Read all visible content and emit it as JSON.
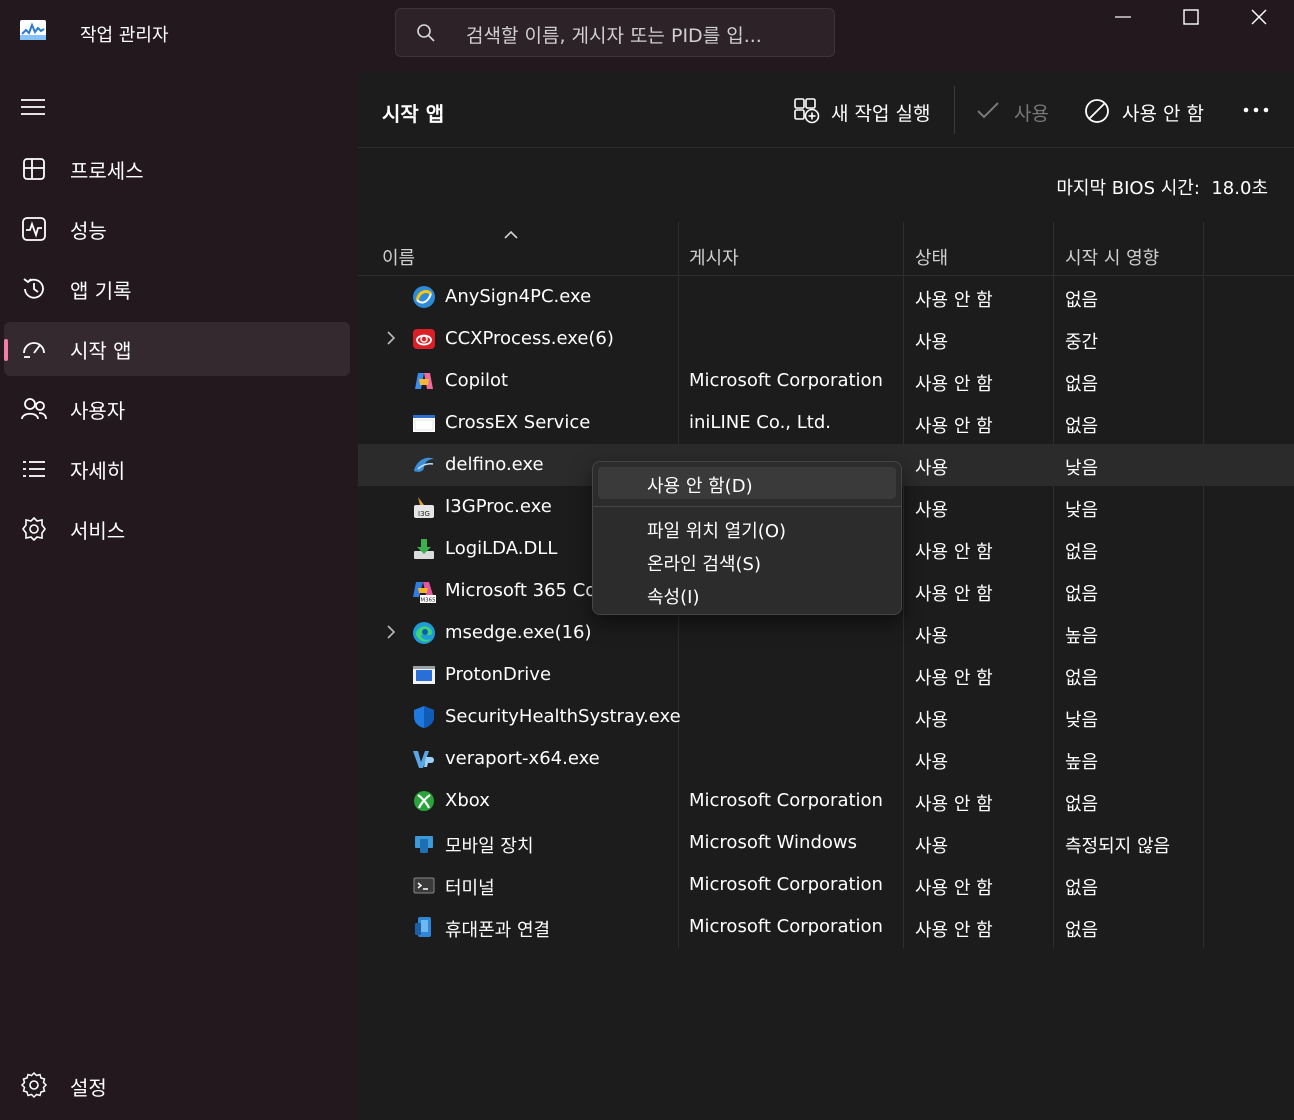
{
  "app": {
    "title": "작업 관리자"
  },
  "search": {
    "placeholder": "검색할 이름, 게시자 또는 PID를 입..."
  },
  "sidebar": {
    "items": [
      {
        "label": "프로세스",
        "icon": "processes-icon"
      },
      {
        "label": "성능",
        "icon": "performance-icon"
      },
      {
        "label": "앱 기록",
        "icon": "app-history-icon"
      },
      {
        "label": "시작 앱",
        "icon": "startup-apps-icon",
        "active": true
      },
      {
        "label": "사용자",
        "icon": "users-icon"
      },
      {
        "label": "자세히",
        "icon": "details-icon"
      },
      {
        "label": "서비스",
        "icon": "services-icon"
      }
    ],
    "settings_label": "설정"
  },
  "toolbar": {
    "page_title": "시작 앱",
    "run_task_label": "새 작업 실행",
    "enable_label": "사용",
    "disable_label": "사용 안 함"
  },
  "bios": {
    "label": "마지막 BIOS 시간:",
    "value": "18.0초"
  },
  "table": {
    "headers": {
      "name": "이름",
      "publisher": "게시자",
      "status": "상태",
      "impact": "시작 시 영향"
    },
    "rows": [
      {
        "name": "AnySign4PC.exe",
        "publisher": "",
        "status": "사용 안 함",
        "impact": "없음"
      },
      {
        "name": "CCXProcess.exe(6)",
        "publisher": "",
        "status": "사용",
        "impact": "중간",
        "expandable": true
      },
      {
        "name": "Copilot",
        "publisher": "Microsoft Corporation",
        "status": "사용 안 함",
        "impact": "없음"
      },
      {
        "name": "CrossEX Service",
        "publisher": "iniLINE Co., Ltd.",
        "status": "사용 안 함",
        "impact": "없음"
      },
      {
        "name": "delfino.exe",
        "publisher": "",
        "status": "사용",
        "impact": "낮음"
      },
      {
        "name": "I3GProc.exe",
        "publisher": "",
        "status": "사용",
        "impact": "낮음"
      },
      {
        "name": "LogiLDA.DLL",
        "publisher": "",
        "status": "사용 안 함",
        "impact": "없음"
      },
      {
        "name": "Microsoft 365 Cop",
        "publisher": "",
        "status": "사용 안 함",
        "impact": "없음"
      },
      {
        "name": "msedge.exe(16)",
        "publisher": "",
        "status": "사용",
        "impact": "높음",
        "expandable": true
      },
      {
        "name": "ProtonDrive",
        "publisher": "",
        "status": "사용 안 함",
        "impact": "없음"
      },
      {
        "name": "SecurityHealthSystray.exe",
        "publisher": "",
        "status": "사용",
        "impact": "낮음"
      },
      {
        "name": "veraport-x64.exe",
        "publisher": "",
        "status": "사용",
        "impact": "높음"
      },
      {
        "name": "Xbox",
        "publisher": "Microsoft Corporation",
        "status": "사용 안 함",
        "impact": "없음"
      },
      {
        "name": "모바일 장치",
        "publisher": "Microsoft Windows",
        "status": "사용",
        "impact": "측정되지 않음"
      },
      {
        "name": "터미널",
        "publisher": "Microsoft Corporation",
        "status": "사용 안 함",
        "impact": "없음"
      },
      {
        "name": "휴대폰과 연결",
        "publisher": "Microsoft Corporation",
        "status": "사용 안 함",
        "impact": "없음"
      }
    ]
  },
  "context_menu": {
    "disable": "사용 안 함(D)",
    "open_location": "파일 위치 열기(O)",
    "search_online": "온라인 검색(S)",
    "properties": "속성(I)"
  },
  "colors": {
    "sidebar_bg": "#22181e",
    "main_bg": "#1c1c1c",
    "accent": "#f07fa3"
  }
}
